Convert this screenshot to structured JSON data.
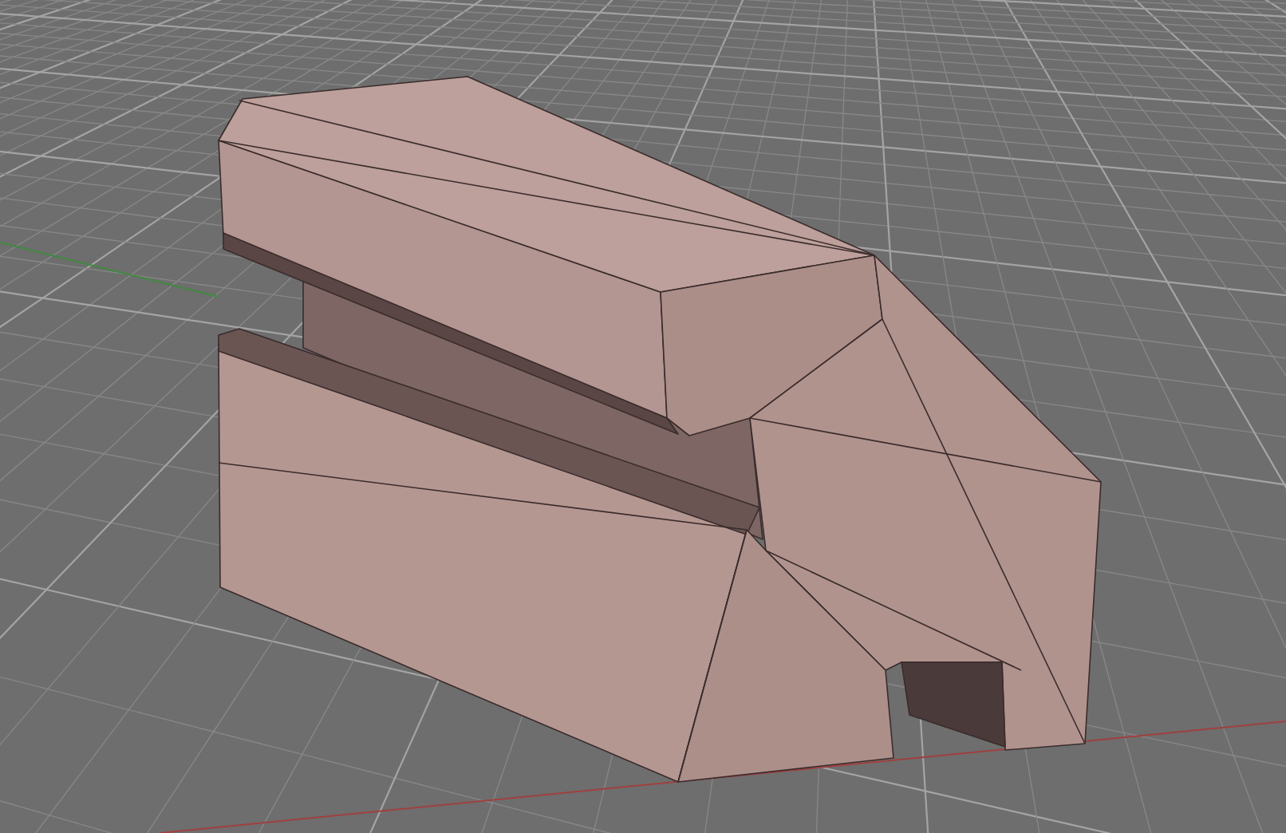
{
  "viewport": {
    "grid": true
  }
}
